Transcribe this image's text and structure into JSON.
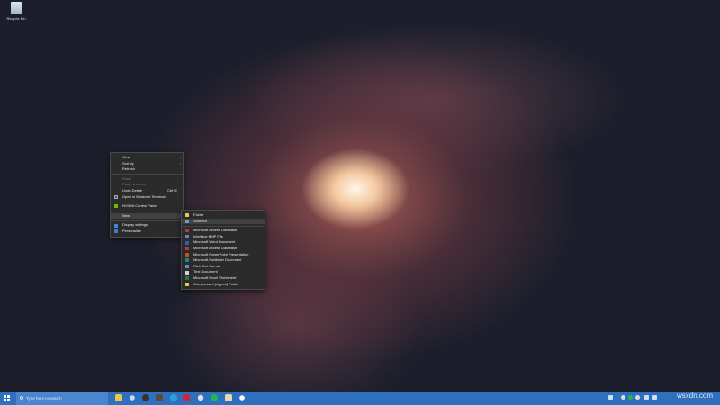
{
  "desktop": {
    "recycle_bin": "Recycle Bin"
  },
  "context_menu": {
    "items": [
      {
        "label": "View",
        "submenu": true
      },
      {
        "label": "Sort by",
        "submenu": true
      },
      {
        "label": "Refresh"
      },
      {
        "label": "Paste",
        "disabled": true
      },
      {
        "label": "Paste shortcut",
        "disabled": true
      },
      {
        "label": "Undo Delete",
        "shortcut": "Ctrl+Z"
      },
      {
        "label": "Open in Windows Terminal"
      },
      {
        "label": "NVIDIA Control Panel"
      },
      {
        "label": "New",
        "submenu": true
      },
      {
        "label": "Display settings"
      },
      {
        "label": "Personalize"
      }
    ]
  },
  "new_submenu": {
    "items": [
      {
        "label": "Folder",
        "color": "#e8c94a"
      },
      {
        "label": "Shortcut",
        "color": "#6aa0c8"
      },
      {
        "label": "Microsoft Access Database",
        "color": "#b03a3a"
      },
      {
        "label": "Interface BMP File",
        "color": "#5a8ac8"
      },
      {
        "label": "Microsoft Word Document",
        "color": "#2b5fb0"
      },
      {
        "label": "Microsoft Access Database",
        "color": "#b03a3a"
      },
      {
        "label": "Microsoft PowerPoint Presentation",
        "color": "#c4502a"
      },
      {
        "label": "Microsoft Publisher Document",
        "color": "#1f8a7a"
      },
      {
        "label": "Rich Text Format",
        "color": "#6a8ac8"
      },
      {
        "label": "Text Document",
        "color": "#cfd8e0"
      },
      {
        "label": "Microsoft Excel Worksheet",
        "color": "#1f7a44"
      },
      {
        "label": "Compressed (zipped) Folder",
        "color": "#e8c94a"
      }
    ]
  },
  "taskbar": {
    "search_placeholder": "Type here to search",
    "time": "wsxdn.com",
    "date": ""
  }
}
